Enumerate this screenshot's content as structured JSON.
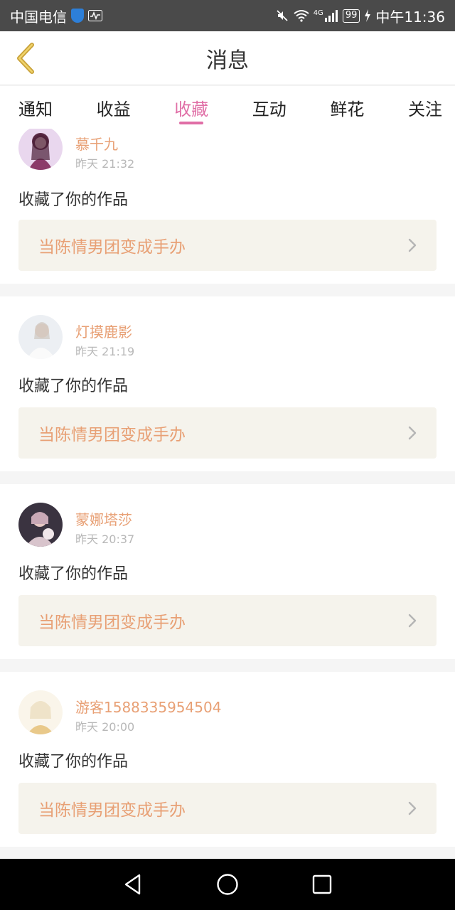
{
  "status_bar": {
    "carrier": "中国电信",
    "battery": "99",
    "time": "中午11:36",
    "network": "4G"
  },
  "header": {
    "title": "消息"
  },
  "tabs": [
    {
      "label": "通知",
      "active": false
    },
    {
      "label": "收益",
      "active": false
    },
    {
      "label": "收藏",
      "active": true
    },
    {
      "label": "互动",
      "active": false
    },
    {
      "label": "鲜花",
      "active": false
    },
    {
      "label": "关注",
      "active": false
    }
  ],
  "items": [
    {
      "user": "慕千九",
      "time": "昨天 21:32",
      "action": "收藏了你的作品",
      "work": "当陈情男团变成手办"
    },
    {
      "user": "灯摸鹿影",
      "time": "昨天 21:19",
      "action": "收藏了你的作品",
      "work": "当陈情男团变成手办"
    },
    {
      "user": "蒙娜塔莎",
      "time": "昨天 20:37",
      "action": "收藏了你的作品",
      "work": "当陈情男团变成手办"
    },
    {
      "user": "游客1588335954504",
      "time": "昨天 20:00",
      "action": "收藏了你的作品",
      "work": "当陈情男团变成手办"
    }
  ],
  "colors": {
    "accent": "#e06ea6",
    "name": "#e8a075",
    "back": "#c9a23a"
  },
  "icons": {
    "back": "chevron-left-icon",
    "item_arrow": "chevron-right-icon",
    "nav": [
      "back-triangle-icon",
      "home-circle-icon",
      "recents-square-icon"
    ]
  }
}
